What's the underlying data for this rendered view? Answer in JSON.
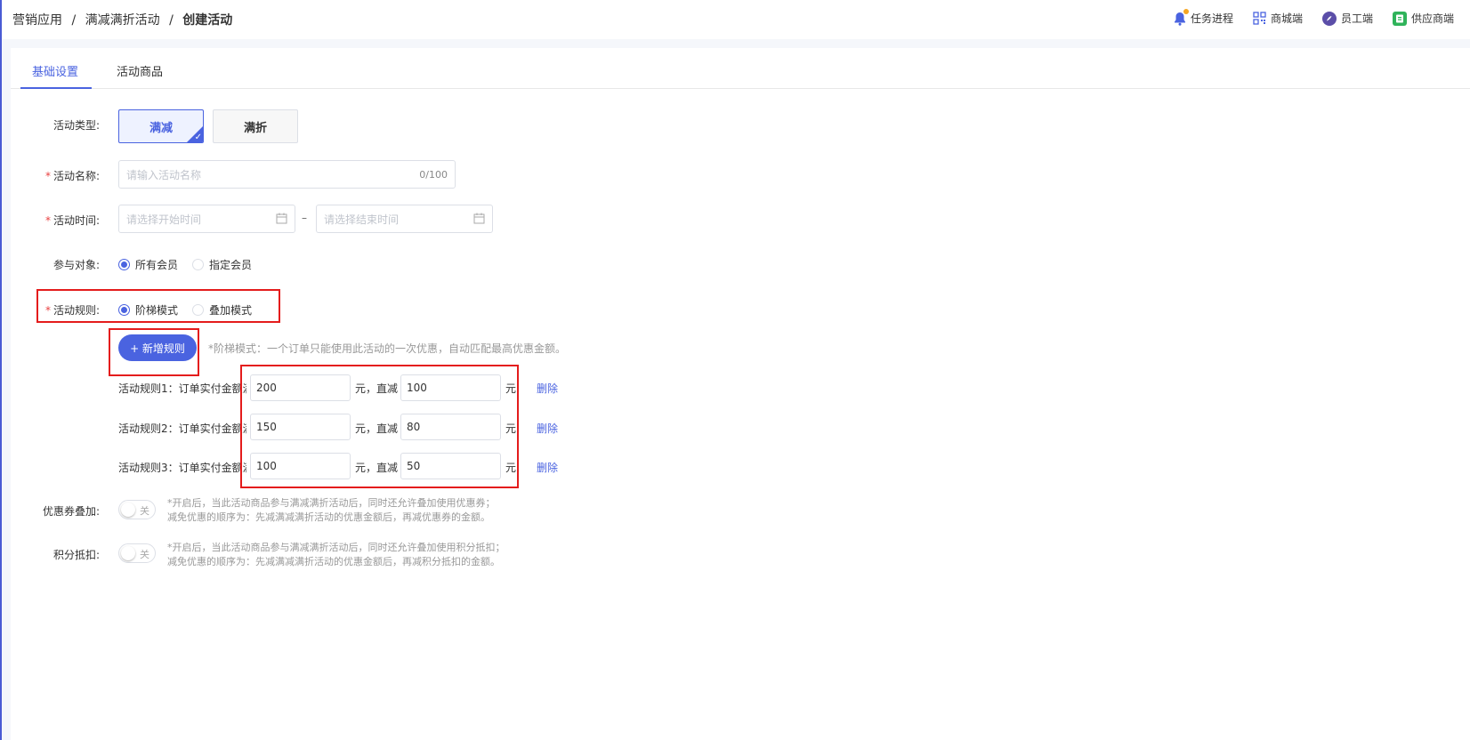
{
  "breadcrumb": {
    "items": [
      "营销应用",
      "满减满折活动",
      "创建活动"
    ],
    "separator": "/"
  },
  "top_actions": {
    "tasks": "任务进程",
    "mall": "商城端",
    "staff": "员工端",
    "supplier": "供应商端"
  },
  "tabs": {
    "basic": "基础设置",
    "products": "活动商品"
  },
  "form": {
    "type": {
      "label": "活动类型:",
      "options": [
        "满减",
        "满折"
      ],
      "selected": "满减"
    },
    "name": {
      "label": "活动名称:",
      "placeholder": "请输入活动名称",
      "counter": "0/100"
    },
    "time": {
      "label": "活动时间:",
      "start_placeholder": "请选择开始时间",
      "end_placeholder": "请选择结束时间",
      "separator": "–"
    },
    "participants": {
      "label": "参与对象:",
      "options": [
        "所有会员",
        "指定会员"
      ],
      "selected": "所有会员"
    },
    "rule_mode": {
      "label": "活动规则:",
      "options": [
        "阶梯模式",
        "叠加模式"
      ],
      "selected": "阶梯模式"
    },
    "add_rule_button": "+ 新增规则",
    "rule_hint": "*阶梯模式：一个订单只能使用此活动的一次优惠，自动匹配最高优惠金额。",
    "rules": [
      {
        "label": "活动规则1：订单实付金额满",
        "threshold": "200",
        "unit1": "元，直减",
        "discount": "100",
        "unit2": "元",
        "delete": "删除"
      },
      {
        "label": "活动规则2：订单实付金额满",
        "threshold": "150",
        "unit1": "元，直减",
        "discount": "80",
        "unit2": "元",
        "delete": "删除"
      },
      {
        "label": "活动规则3：订单实付金额满",
        "threshold": "100",
        "unit1": "元，直减",
        "discount": "50",
        "unit2": "元",
        "delete": "删除"
      }
    ],
    "coupon_stack": {
      "label": "优惠券叠加:",
      "toggle": "关",
      "note_line1": "*开启后，当此活动商品参与满减满折活动后，同时还允许叠加使用优惠券；",
      "note_line2": "减免优惠的顺序为：先减满减满折活动的优惠金额后，再减优惠券的金额。"
    },
    "points_deduct": {
      "label": "积分抵扣:",
      "toggle": "关",
      "note_line1": "*开启后，当此活动商品参与满减满折活动后，同时还允许叠加使用积分抵扣；",
      "note_line2": "减免优惠的顺序为：先减满减满折活动的优惠金额后，再减积分抵扣的金额。"
    }
  },
  "colors": {
    "accent": "#4a63e0",
    "required": "#e94040",
    "highlight": "#e41c1c"
  }
}
